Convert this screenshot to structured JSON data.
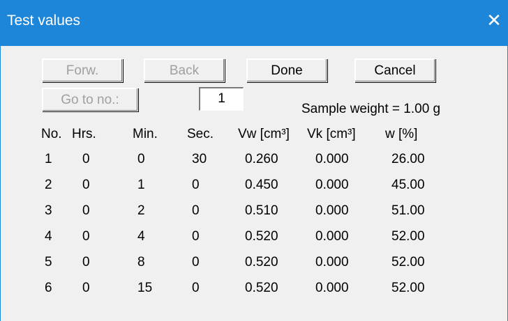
{
  "window": {
    "title": "Test values",
    "close_glyph": "✕",
    "accent": "#1e86d8"
  },
  "buttons": {
    "forward": "Forw.",
    "back": "Back",
    "done": "Done",
    "cancel": "Cancel",
    "goto": "Go to no.:"
  },
  "record_number": "1",
  "sample_weight": "Sample weight = 1.00 g",
  "table": {
    "headers": [
      "No.",
      "Hrs.",
      "Min.",
      "Sec.",
      "Vw [cm³]",
      "Vk [cm³]",
      "w [%]"
    ],
    "rows": [
      [
        "1",
        "0",
        "0",
        "30",
        "0.260",
        "0.000",
        "26.00"
      ],
      [
        "2",
        "0",
        "1",
        "0",
        "0.450",
        "0.000",
        "45.00"
      ],
      [
        "3",
        "0",
        "2",
        "0",
        "0.510",
        "0.000",
        "51.00"
      ],
      [
        "4",
        "0",
        "4",
        "0",
        "0.520",
        "0.000",
        "52.00"
      ],
      [
        "5",
        "0",
        "8",
        "0",
        "0.520",
        "0.000",
        "52.00"
      ],
      [
        "6",
        "0",
        "15",
        "0",
        "0.520",
        "0.000",
        "52.00"
      ]
    ]
  }
}
